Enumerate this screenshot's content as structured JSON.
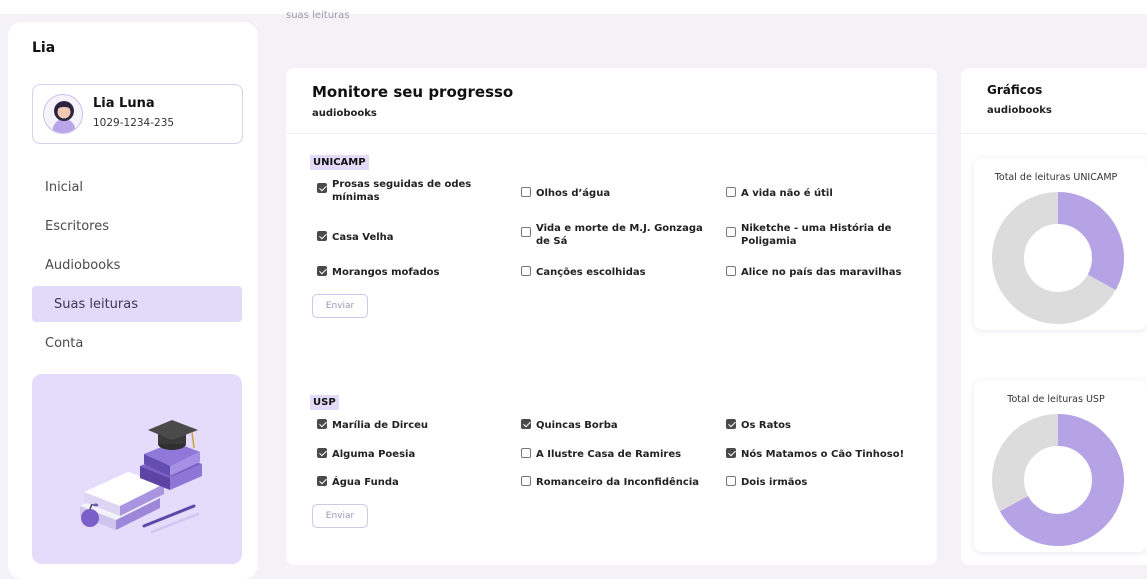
{
  "header": {
    "breadcrumb": "suas leituras"
  },
  "sidebar": {
    "brand": "Lia",
    "user": {
      "name": "Lia Luna",
      "id": "1029-1234-235"
    },
    "nav": [
      {
        "label": "Inicial",
        "active": false
      },
      {
        "label": "Escritores",
        "active": false
      },
      {
        "label": "Audiobooks",
        "active": false
      },
      {
        "label": "Suas leituras",
        "active": true
      },
      {
        "label": "Conta",
        "active": false
      }
    ]
  },
  "main": {
    "title": "Monitore seu progresso",
    "subtitle": "audiobooks",
    "sections": [
      {
        "name": "UNICAMP",
        "button": "Enviar",
        "items": [
          {
            "label": "Prosas seguidas de odes mínimas",
            "checked": true
          },
          {
            "label": "Olhos d’água",
            "checked": false
          },
          {
            "label": "A vida não é útil",
            "checked": false
          },
          {
            "label": "Casa Velha",
            "checked": true
          },
          {
            "label": "Vida e morte de M.J. Gonzaga de Sá",
            "checked": false
          },
          {
            "label": "Niketche - uma História de Poligamia",
            "checked": false
          },
          {
            "label": "Morangos mofados",
            "checked": true
          },
          {
            "label": "Canções escolhidas",
            "checked": false
          },
          {
            "label": "Alice no país das maravilhas",
            "checked": false
          }
        ]
      },
      {
        "name": "USP",
        "button": "Enviar",
        "items": [
          {
            "label": "Marília de Dirceu",
            "checked": true
          },
          {
            "label": "Quincas Borba",
            "checked": true
          },
          {
            "label": "Os Ratos",
            "checked": true
          },
          {
            "label": "Alguma Poesia",
            "checked": true
          },
          {
            "label": "A Ilustre Casa de Ramires",
            "checked": false
          },
          {
            "label": "Nós Matamos o Cão Tinhoso!",
            "checked": true
          },
          {
            "label": "Água Funda",
            "checked": true
          },
          {
            "label": "Romanceiro da Inconfidência",
            "checked": false
          },
          {
            "label": "Dois irmãos",
            "checked": false
          }
        ]
      }
    ]
  },
  "charts": {
    "title": "Gráficos",
    "subtitle": "audiobooks",
    "items": [
      {
        "title": "Total de leituras UNICAMP",
        "read_fraction": 0.33
      },
      {
        "title": "Total de leituras USP",
        "read_fraction": 0.67
      }
    ],
    "colors": {
      "read": "#b6a3e6",
      "unread": "#dcdcdc"
    }
  }
}
